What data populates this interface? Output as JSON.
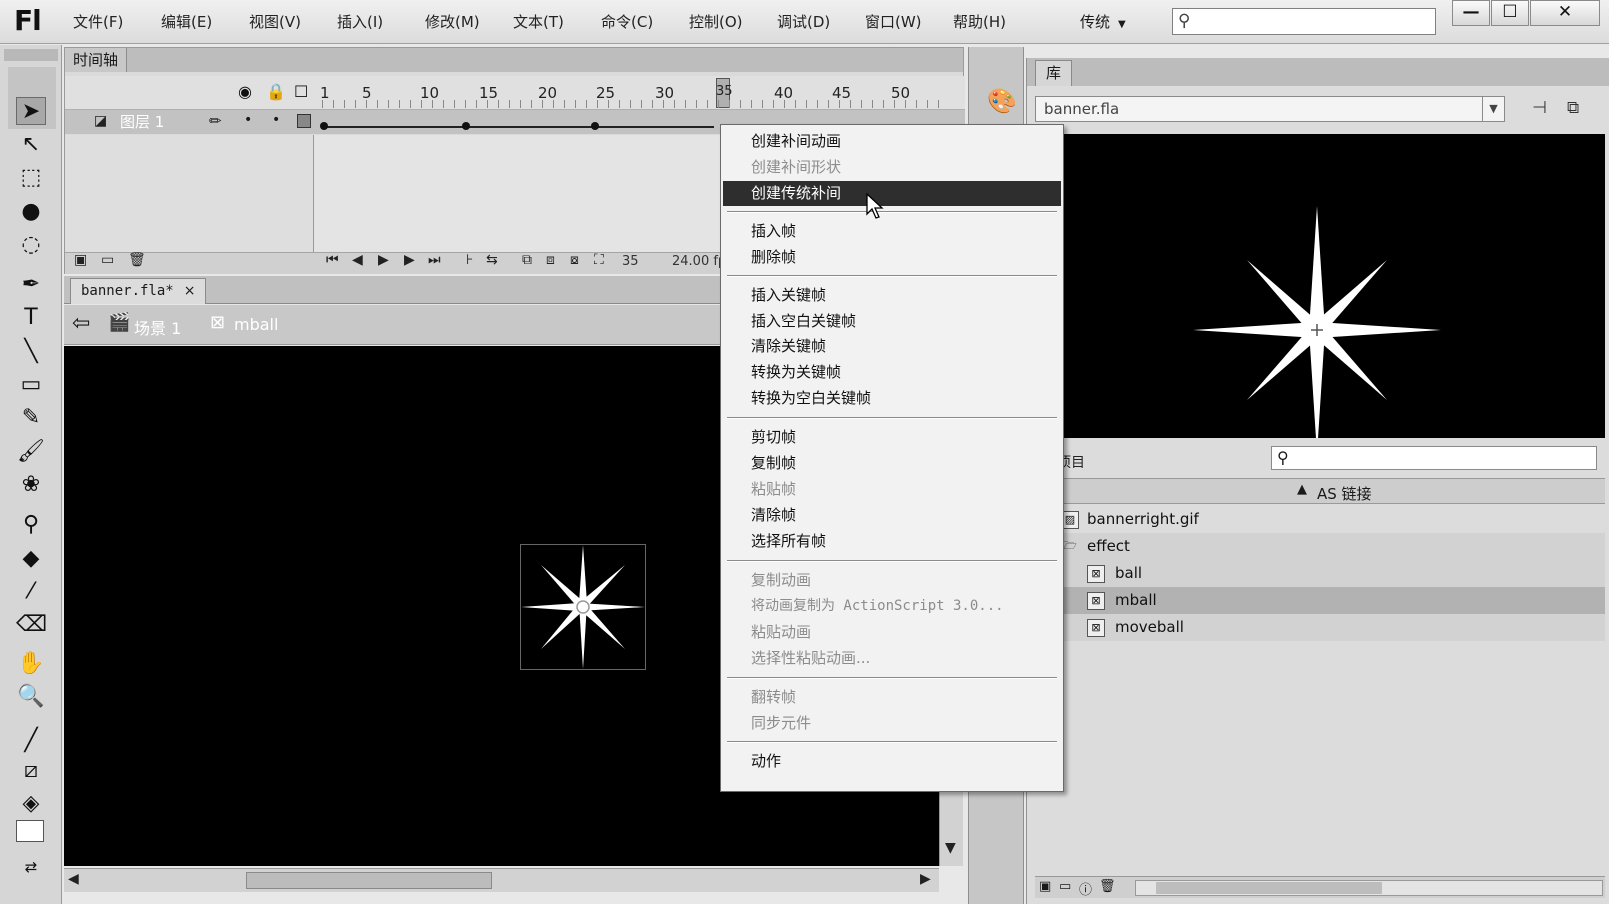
{
  "app": {
    "logo": "Fl",
    "menu": [
      "文件(F)",
      "编辑(E)",
      "视图(V)",
      "插入(I)",
      "修改(M)",
      "文本(T)",
      "命令(C)",
      "控制(O)",
      "调试(D)",
      "窗口(W)",
      "帮助(H)"
    ],
    "workspace": "传统",
    "search_icon": "magnifier-icon",
    "window_buttons": [
      "—",
      "☐",
      "✕"
    ]
  },
  "timeline": {
    "tab": "时间轴",
    "frame_numbers": [
      "1",
      "5",
      "10",
      "15",
      "20",
      "25",
      "30",
      "35",
      "40",
      "45",
      "50"
    ],
    "current_frame": "35",
    "layer": {
      "name": "图层 1"
    },
    "frame_rate": "24.00 fps"
  },
  "document": {
    "tab": "banner.fla*",
    "tab_close": "×",
    "scene": "场景 1",
    "symbol": "mball"
  },
  "library": {
    "tab": "库",
    "document": "banner.fla",
    "count_label": "项目",
    "linkage_column": "AS 链接",
    "items": [
      {
        "name": "bannerright.gif",
        "icon": "bitmap-icon"
      },
      {
        "name": "effect",
        "icon": "folder-icon"
      },
      {
        "name": "ball",
        "icon": "movieclip-icon"
      },
      {
        "name": "mball",
        "icon": "movieclip-icon"
      },
      {
        "name": "moveball",
        "icon": "movieclip-icon"
      }
    ]
  },
  "context_menu": {
    "items": [
      {
        "label": "创建补间动画",
        "disabled": false
      },
      {
        "label": "创建补间形状",
        "disabled": true
      },
      {
        "label": "创建传统补间",
        "disabled": false,
        "highlighted": true
      },
      {
        "label": "插入帧",
        "disabled": false
      },
      {
        "label": "删除帧",
        "disabled": false
      },
      {
        "label": "插入关键帧",
        "disabled": false
      },
      {
        "label": "插入空白关键帧",
        "disabled": false
      },
      {
        "label": "清除关键帧",
        "disabled": false
      },
      {
        "label": "转换为关键帧",
        "disabled": false
      },
      {
        "label": "转换为空白关键帧",
        "disabled": false
      },
      {
        "label": "剪切帧",
        "disabled": false
      },
      {
        "label": "复制帧",
        "disabled": false
      },
      {
        "label": "粘贴帧",
        "disabled": true
      },
      {
        "label": "清除帧",
        "disabled": false
      },
      {
        "label": "选择所有帧",
        "disabled": false
      },
      {
        "label": "复制动画",
        "disabled": true
      },
      {
        "label": "将动画复制为 ActionScript 3.0...",
        "disabled": true
      },
      {
        "label": "粘贴动画",
        "disabled": true
      },
      {
        "label": "选择性粘贴动画...",
        "disabled": true
      },
      {
        "label": "翻转帧",
        "disabled": true
      },
      {
        "label": "同步元件",
        "disabled": true
      },
      {
        "label": "动作",
        "disabled": false
      }
    ]
  },
  "colors": {
    "stage": "#000000",
    "menu_highlight": "#2e2e2e",
    "disabled_text": "#8c8c8c"
  }
}
